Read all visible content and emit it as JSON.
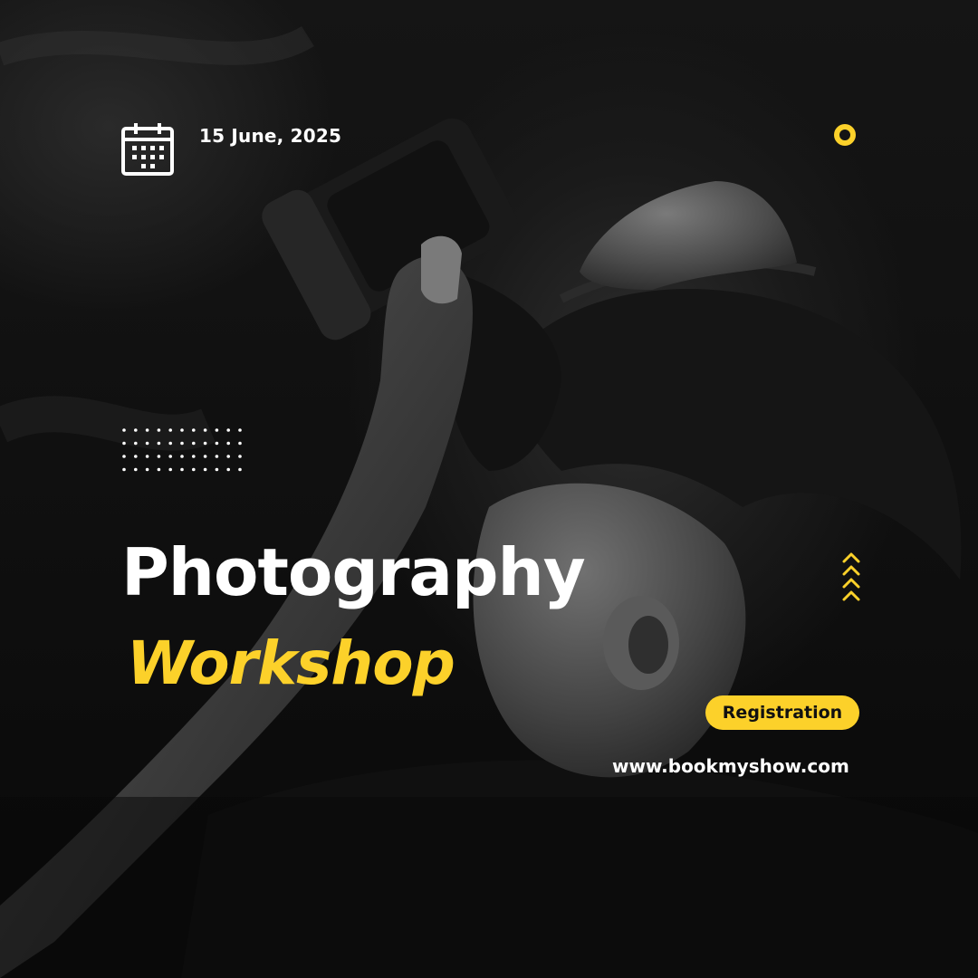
{
  "event": {
    "date": "15 June, 2025",
    "title_line1": "Photography",
    "title_line2": "Workshop"
  },
  "cta": {
    "registration_label": "Registration",
    "website": "www.bookmyshow.com"
  },
  "icons": {
    "calendar": "calendar-icon",
    "ring": "ring-icon",
    "dot_grid": "dot-grid-pattern",
    "chevrons": "chevron-up-icon"
  },
  "colors": {
    "accent": "#fcd12a",
    "text": "#ffffff",
    "background": "#0b0b0b"
  }
}
